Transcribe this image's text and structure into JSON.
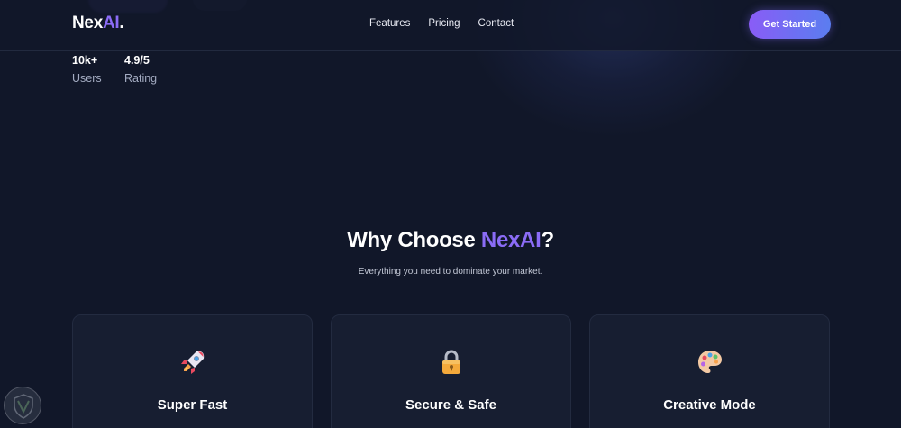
{
  "brand": {
    "name": "Nex",
    "accent": "AI",
    "dot": ".",
    "accent_color": "#8b6cf6"
  },
  "nav": {
    "links": [
      {
        "label": "Features"
      },
      {
        "label": "Pricing"
      },
      {
        "label": "Contact"
      }
    ],
    "cta_label": "Get Started"
  },
  "stats": [
    {
      "value": "10k+",
      "label": "Users"
    },
    {
      "value": "4.9/5",
      "label": "Rating"
    }
  ],
  "section": {
    "title_prefix": "Why Choose ",
    "title_accent": "NexAI",
    "title_suffix": "?",
    "subtitle": "Everything you need to dominate your market."
  },
  "features": [
    {
      "icon": "rocket-icon",
      "title": "Super Fast"
    },
    {
      "icon": "lock-icon",
      "title": "Secure & Safe"
    },
    {
      "icon": "palette-icon",
      "title": "Creative Mode"
    }
  ],
  "colors": {
    "background": "#111729",
    "card": "#171e31",
    "accent": "#8b6cf6",
    "cta_gradient": [
      "#8a5cf6",
      "#5b7df0"
    ]
  }
}
